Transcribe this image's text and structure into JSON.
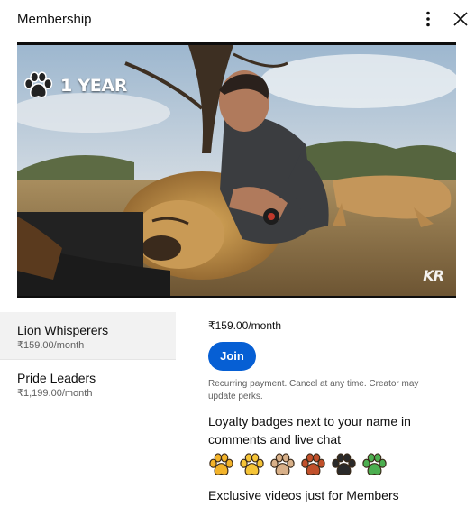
{
  "header": {
    "title": "Membership"
  },
  "video": {
    "badge_label": "1 YEAR",
    "watermark": "KR"
  },
  "tiers": [
    {
      "name": "Lion Whisperers",
      "price": "₹159.00/month",
      "selected": true
    },
    {
      "name": "Pride Leaders",
      "price": "₹1,199.00/month",
      "selected": false
    }
  ],
  "details": {
    "price": "₹159.00/month",
    "join_label": "Join",
    "note": "Recurring payment. Cancel at any time. Creator may update perks.",
    "perk_badges": "Loyalty badges next to your name in comments and live chat",
    "badge_colors": [
      "#f2b32a",
      "#f5c437",
      "#d8b089",
      "#c1502b",
      "#2a2a2a",
      "#4caf50"
    ],
    "perk_videos": "Exclusive videos just for Members"
  },
  "icons": {
    "more": "more-vert-icon",
    "close": "close-icon",
    "badge": "paw-icon"
  }
}
